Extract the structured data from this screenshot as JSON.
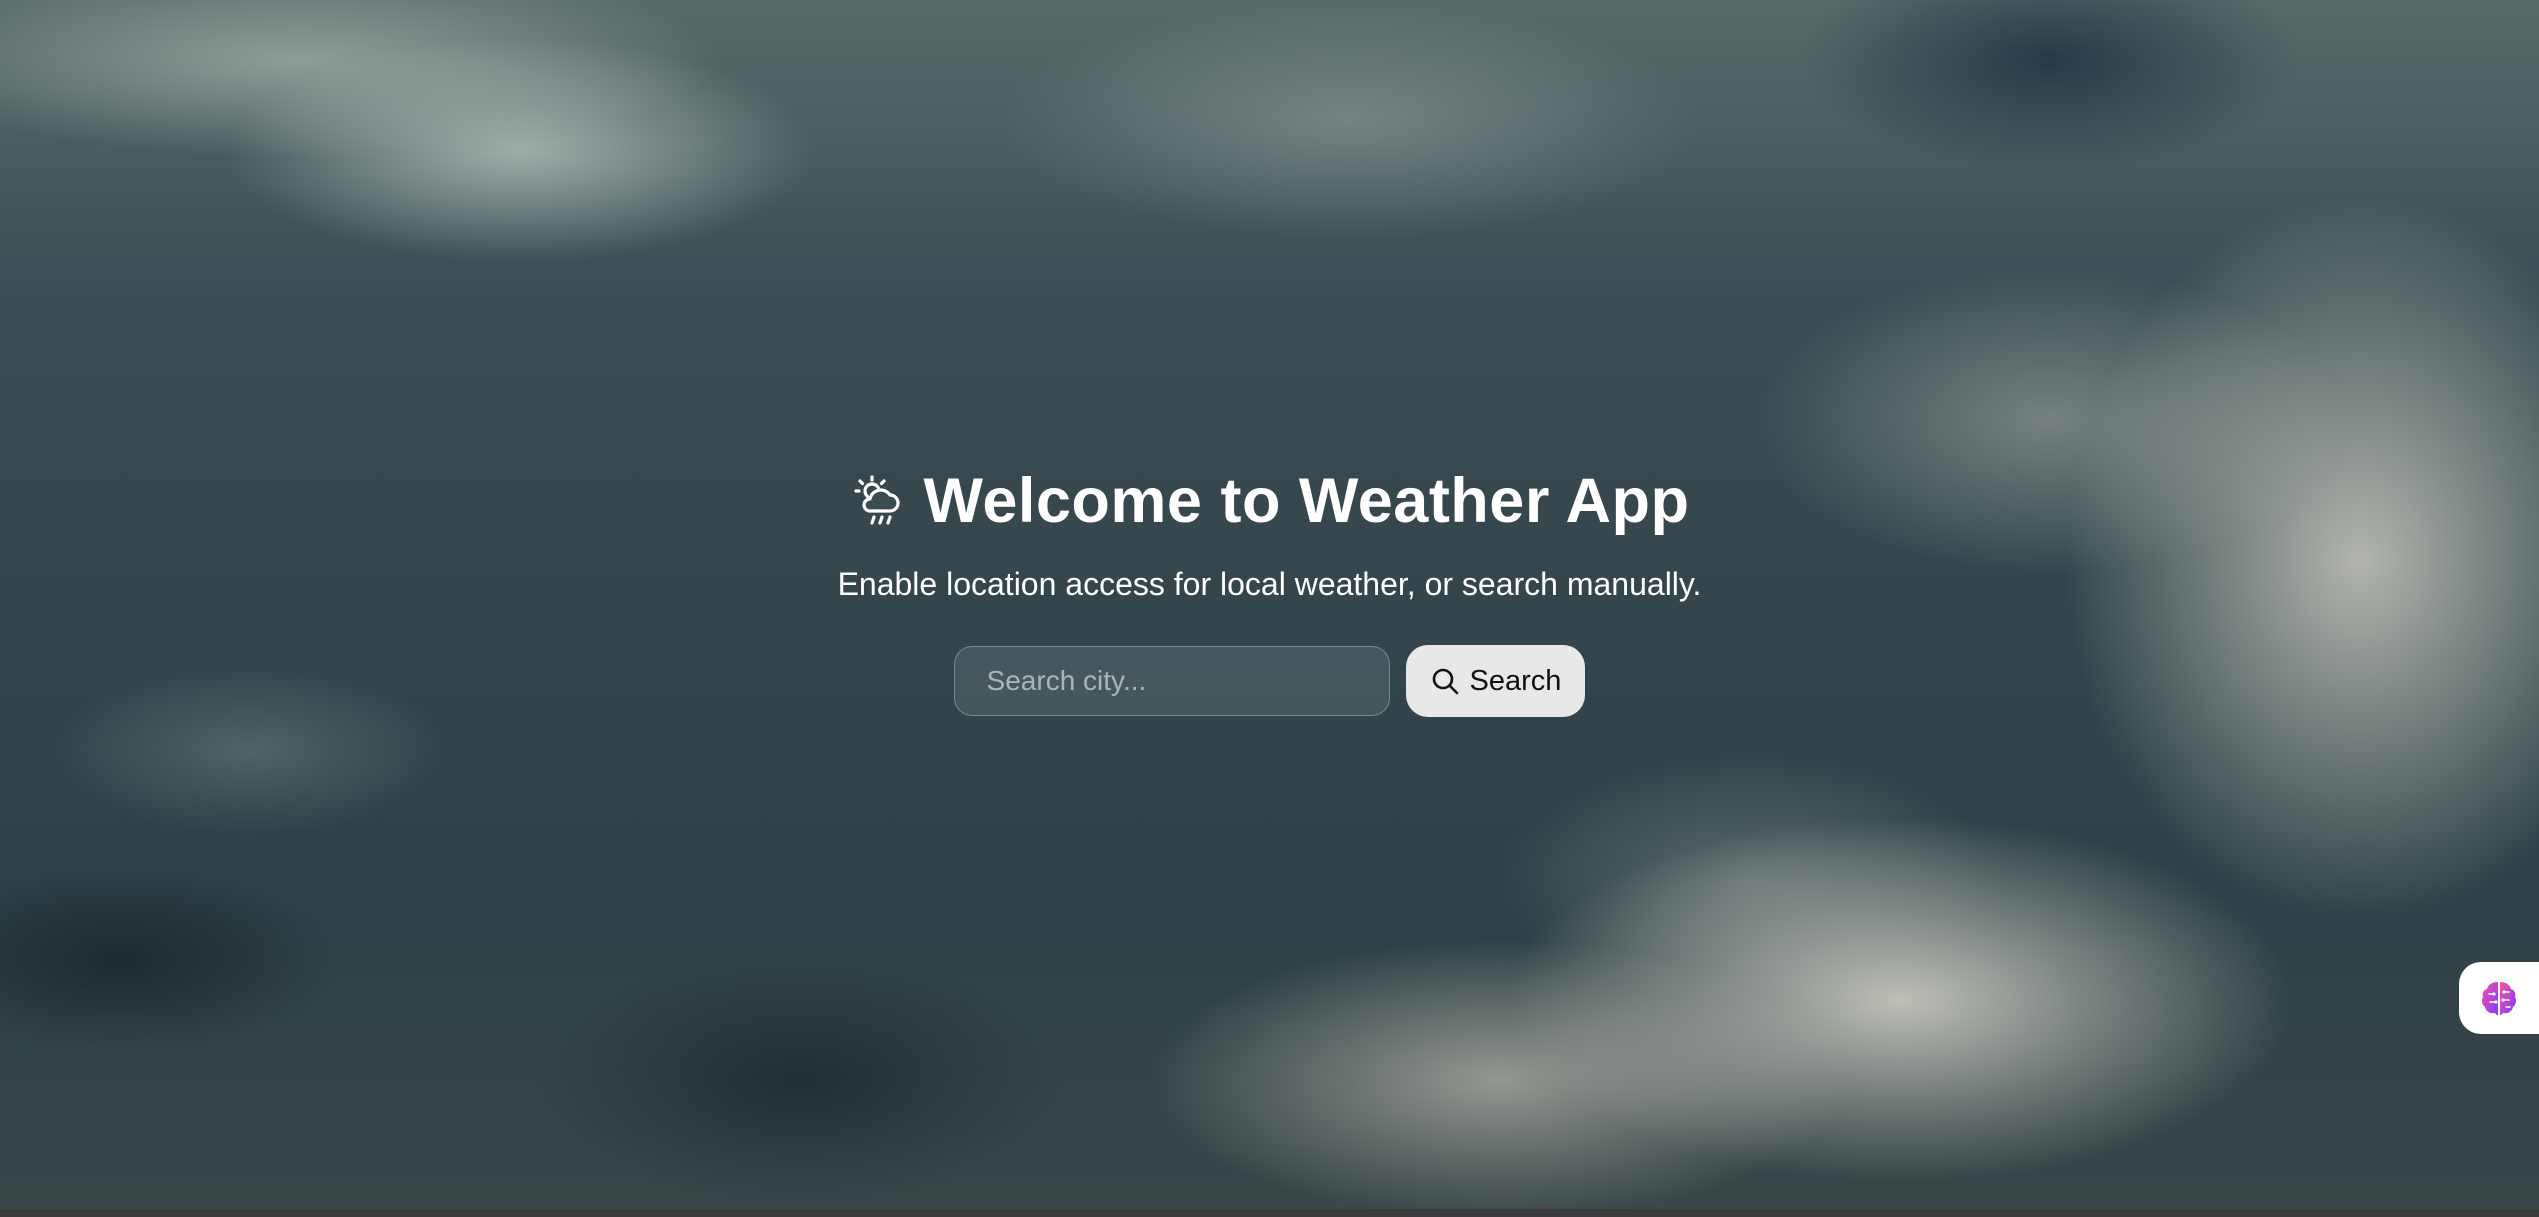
{
  "hero": {
    "title": "Welcome to Weather App",
    "subtitle": "Enable location access for local weather, or search manually.",
    "icon": "cloud-sun-rain-icon"
  },
  "search": {
    "placeholder": "Search city...",
    "value": "",
    "button_label": "Search",
    "button_icon": "search-icon"
  },
  "assistant": {
    "icon": "brain-icon"
  },
  "colors": {
    "text": "#ffffff",
    "button_bg": "#e8e8e8",
    "button_text": "#111111"
  }
}
